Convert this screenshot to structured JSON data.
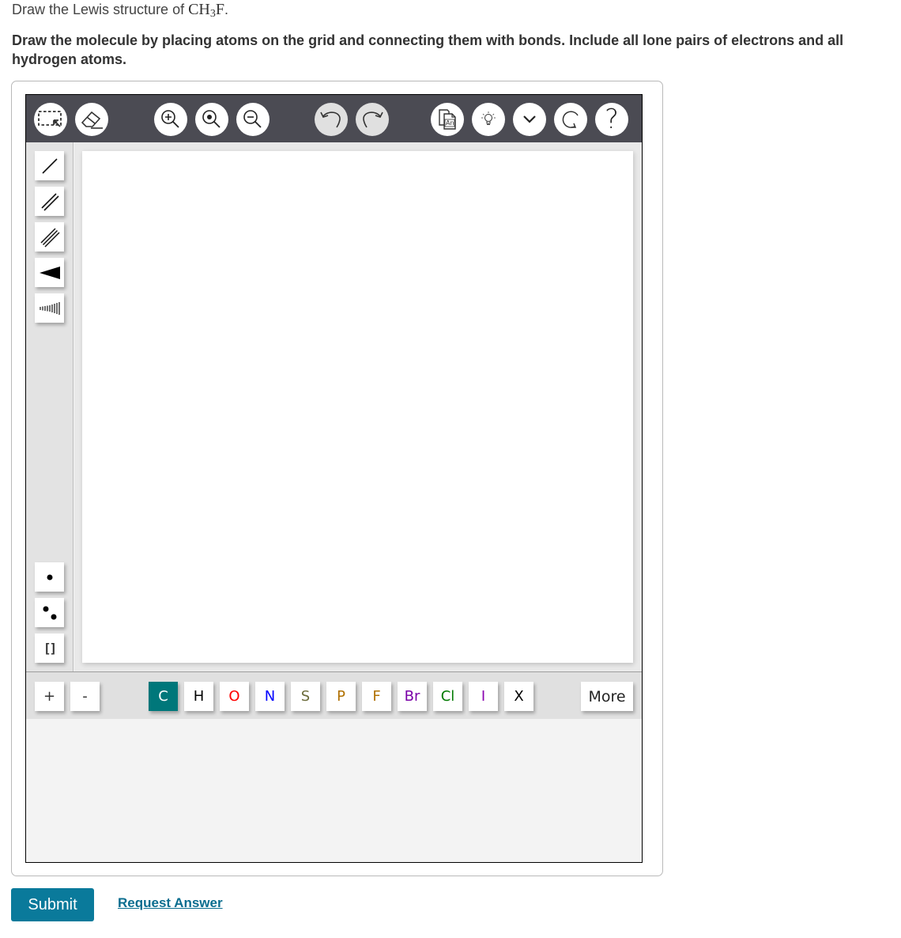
{
  "question": {
    "prompt_prefix": "Draw the Lewis structure of ",
    "formula_main": "CH",
    "formula_sub": "3",
    "formula_end": "F",
    "formula_period": ".",
    "instructions": "Draw the molecule by placing atoms on the grid and connecting them with bonds. Include all lone pairs of electrons and all hydrogen atoms."
  },
  "top_toolbar": [
    {
      "name": "select-tool",
      "icon": "marquee-select-icon",
      "enabled": true
    },
    {
      "name": "eraser-tool",
      "icon": "eraser-icon",
      "enabled": true
    },
    {
      "name": "zoom-in",
      "icon": "zoom-in-icon",
      "enabled": true
    },
    {
      "name": "zoom-reset",
      "icon": "zoom-fit-icon",
      "enabled": true
    },
    {
      "name": "zoom-out",
      "icon": "zoom-out-icon",
      "enabled": true
    },
    {
      "name": "undo",
      "icon": "undo-icon",
      "enabled": false
    },
    {
      "name": "redo",
      "icon": "redo-icon",
      "enabled": false
    },
    {
      "name": "templates",
      "icon": "copy-template-icon",
      "enabled": true,
      "badge": "An"
    },
    {
      "name": "hint",
      "icon": "lightbulb-icon",
      "enabled": true
    },
    {
      "name": "more-options",
      "icon": "chevron-down-icon",
      "enabled": true
    },
    {
      "name": "reset",
      "icon": "reset-icon",
      "enabled": true
    },
    {
      "name": "help",
      "icon": "help-icon",
      "enabled": true,
      "glyph": "?"
    }
  ],
  "left_toolbar": {
    "bonds": [
      {
        "name": "single-bond",
        "icon": "single-bond-icon"
      },
      {
        "name": "double-bond",
        "icon": "double-bond-icon"
      },
      {
        "name": "triple-bond",
        "icon": "triple-bond-icon"
      },
      {
        "name": "wedge-bond",
        "icon": "wedge-bond-icon"
      },
      {
        "name": "hash-bond",
        "icon": "hash-bond-icon"
      }
    ],
    "electrons": [
      {
        "name": "radical",
        "icon": "single-electron-icon"
      },
      {
        "name": "lone-pair",
        "icon": "lone-pair-icon"
      },
      {
        "name": "brackets",
        "icon": "brackets-icon",
        "glyph": "[]"
      }
    ]
  },
  "charge_buttons": [
    {
      "label": "+",
      "name": "increase-charge"
    },
    {
      "label": "-",
      "name": "decrease-charge"
    }
  ],
  "elements": [
    {
      "symbol": "C",
      "color": "#ffffff",
      "selected": true
    },
    {
      "symbol": "H",
      "color": "#000000",
      "selected": false
    },
    {
      "symbol": "O",
      "color": "#ff0000",
      "selected": false
    },
    {
      "symbol": "N",
      "color": "#0000ff",
      "selected": false
    },
    {
      "symbol": "S",
      "color": "#6b6b3a",
      "selected": false
    },
    {
      "symbol": "P",
      "color": "#b07000",
      "selected": false
    },
    {
      "symbol": "F",
      "color": "#b07000",
      "selected": false
    },
    {
      "symbol": "Br",
      "color": "#7a00a8",
      "selected": false
    },
    {
      "symbol": "Cl",
      "color": "#007a00",
      "selected": false
    },
    {
      "symbol": "I",
      "color": "#8a00b0",
      "selected": false
    },
    {
      "symbol": "X",
      "color": "#000000",
      "selected": false
    }
  ],
  "more_label": "More",
  "colors": {
    "toolbar_bg": "#4b4b53",
    "selected_element": "#00777a",
    "submit_bg": "#0a7a9b",
    "link": "#0a6d8f"
  },
  "actions": {
    "submit_label": "Submit",
    "request_answer_label": "Request Answer"
  }
}
